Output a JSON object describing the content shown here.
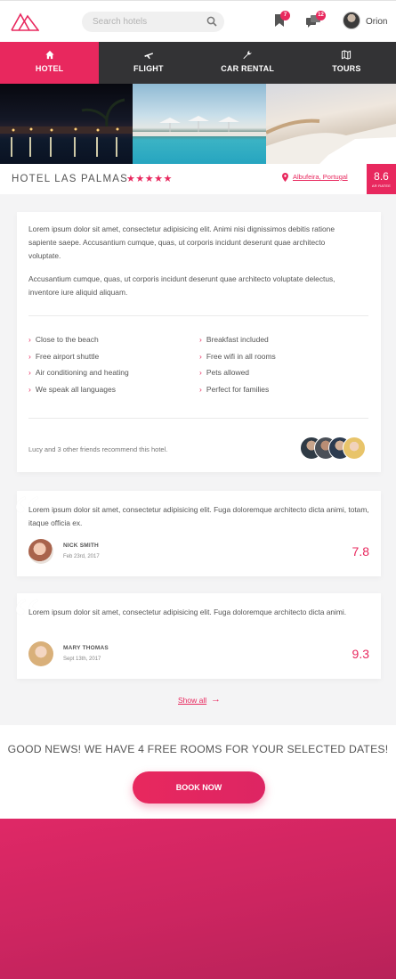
{
  "header": {
    "search_placeholder": "Search hotels",
    "bookmark_badge": "7",
    "chat_badge": "12",
    "user_name": "Orion"
  },
  "tabs": [
    {
      "label": "HOTEL",
      "icon": "home-icon",
      "active": true
    },
    {
      "label": "FLIGHT",
      "icon": "plane-icon",
      "active": false
    },
    {
      "label": "CAR RENTAL",
      "icon": "wrench-icon",
      "active": false
    },
    {
      "label": "TOURS",
      "icon": "map-icon",
      "active": false
    }
  ],
  "hotel": {
    "name": "HOTEL LAS PALMAS",
    "stars": "★★★★★",
    "location": "Albufeira, Portugal",
    "score": "8.6",
    "score_sub": "AR RATEE"
  },
  "description": {
    "p1": "Lorem ipsum dolor sit amet, consectetur adipisicing elit. Animi nisi dignissimos debitis ratione sapiente saepe. Accusantium cumque, quas, ut corporis incidunt deserunt quae architecto voluptate.",
    "p2": "Accusantium cumque, quas, ut corporis incidunt deserunt quae architecto voluptate delectus, inventore iure aliquid aliquam.",
    "features_left": [
      "Close to the beach",
      "Free airport shuttle",
      "Air conditioning and heating",
      "We speak all languages"
    ],
    "features_right": [
      "Breakfast included",
      "Free wifi in all rooms",
      "Pets allowed",
      "Perfect for families"
    ],
    "recommend": "Lucy and 3 other friends recommend this hotel."
  },
  "reviews": [
    {
      "text": "Lorem ipsum dolor sit amet, consectetur adipisicing elit. Fuga doloremque architecto dicta animi, totam, itaque officia ex.",
      "name": "NICK SMITH",
      "date": "Feb 23rd, 2017",
      "score": "7.8"
    },
    {
      "text": "Lorem ipsum dolor sit amet, consectetur adipisicing elit. Fuga doloremque architecto dicta animi.",
      "name": "MARY THOMAS",
      "date": "Sept 13th, 2017",
      "score": "9.3"
    }
  ],
  "show_all": "Show all",
  "news": {
    "text": "GOOD NEWS! WE HAVE 4 FREE ROOMS FOR YOUR SELECTED DATES!",
    "button": "BOOK NOW"
  },
  "colors": {
    "accent": "#e8285e",
    "nav_bg": "#333335"
  }
}
